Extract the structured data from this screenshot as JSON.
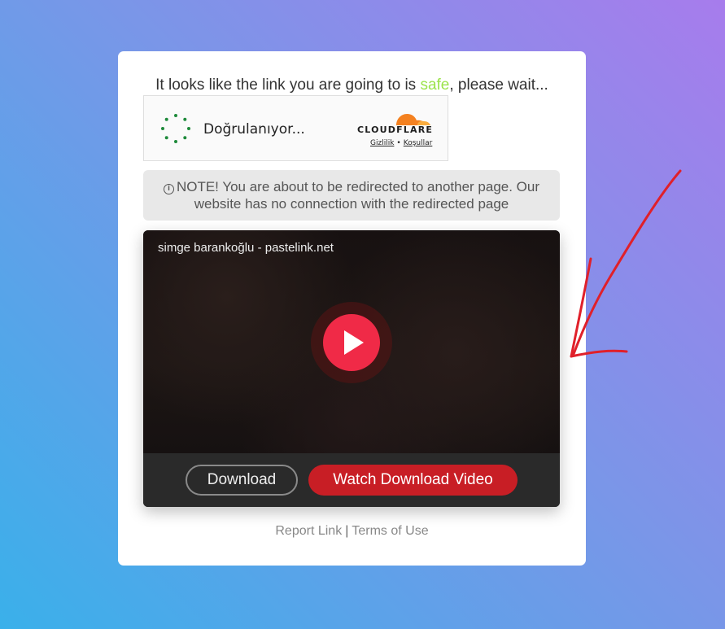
{
  "headline": {
    "prefix": "It looks like the link you are going to is ",
    "highlight": "safe",
    "suffix": ", please wait..."
  },
  "captcha": {
    "status": "Doğrulanıyor...",
    "brand": "CLOUDFLARE",
    "privacy": "Gizlilik",
    "separator": "•",
    "terms": "Koşullar"
  },
  "note": {
    "text": "NOTE! You are about to be redirected to another page. Our website has no connection with the redirected page"
  },
  "video": {
    "title": "simge barankoğlu - pastelink.net",
    "download_label": "Download",
    "watch_label": "Watch Download Video"
  },
  "footer": {
    "report": "Report Link",
    "separator": "|",
    "terms": "Terms of Use"
  },
  "colors": {
    "safe": "#9be34a",
    "play": "#f02a47",
    "watch_button": "#c81e25",
    "annotation": "#e0202a"
  }
}
